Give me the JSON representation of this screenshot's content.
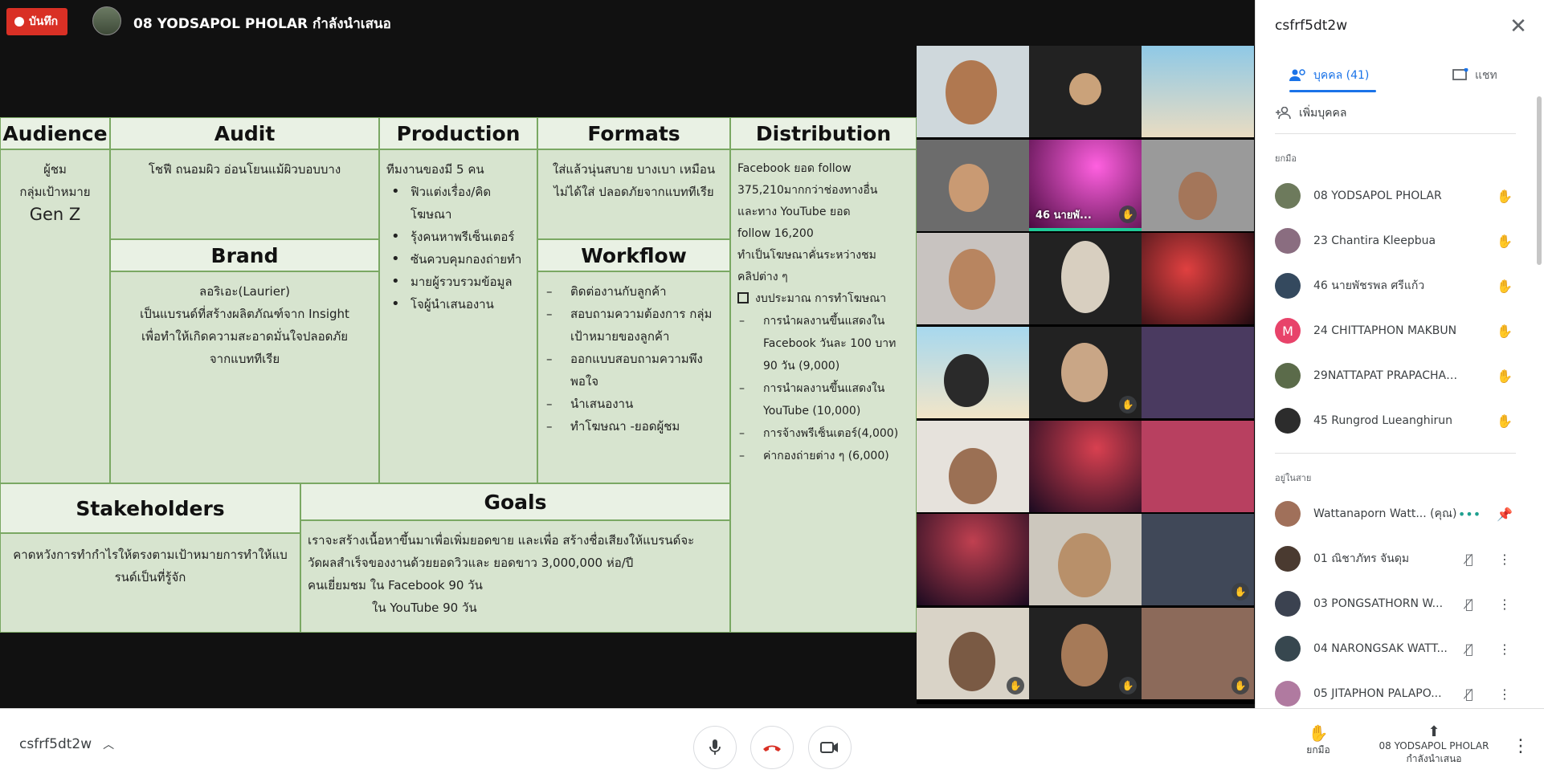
{
  "meeting": {
    "record_label": "บันทึก",
    "presenter_status": "08 YODSAPOL PHOLAR กำลังนำเสนอ",
    "code": "csfrf5dt2w"
  },
  "slide": {
    "audience": {
      "title": "Audience",
      "line1": "ผู้ชม",
      "line2": "กลุ่มเป้าหมาย",
      "line3": "Gen Z"
    },
    "audit": {
      "title": "Audit",
      "text": "โชฟี ถนอมผิว อ่อนโยนแม้ผิวบอบบาง"
    },
    "brand": {
      "title": "Brand",
      "line1": "ลอริเอะ(Laurier)",
      "line2": "เป็นแบรนด์ที่สร้างผลิตภัณฑ์จาก Insight",
      "line3": "เพื่อทำให้เกิดความสะอาดมั่นใจปลอดภัย",
      "line4": "จากแบททีเรีย"
    },
    "production": {
      "title": "Production",
      "intro": "ทีมงานของมี 5 คน",
      "items": [
        "ฟิวแต่งเรื่อง/คิดโฆษณา",
        "รุ้งคนหาพรีเซ็นเตอร์",
        "ซันควบคุมกองถ่ายทำ",
        "มายผู้รวบรวมข้อมูล",
        "โจผู้นำเสนองาน"
      ]
    },
    "formats": {
      "title": "Formats",
      "line1": "ใส่แล้วนุ่นสบาย บางเบา เหมือน",
      "line2": "ไม่ได้ใส่ ปลอดภัยจากแบททีเรีย"
    },
    "workflow": {
      "title": "Workflow",
      "items": [
        "ติดต่องานกับลูกค้า",
        "สอบถามความต้องการ กลุ่มเป้าหมายของลูกค้า",
        "ออกแบบสอบถามความพึงพอใจ",
        "นำเสนองาน",
        "ทำโฆษณา -ยอดผู้ชม"
      ]
    },
    "distribution": {
      "title": "Distribution",
      "l1": "Facebook ยอด follow",
      "l2": "375,210มากกว่าช่องทางอื่น",
      "l3": "และทาง YouTube ยอด",
      "l4": "follow 16,200",
      "l5": "ทำเป็นโฆษณาคั่นระหว่างชม",
      "l6": "คลิปต่าง ๆ",
      "budget": "งบประมาณ การทำโฆษณา",
      "items": [
        "การนำผลงานขึ้นแสดงใน Facebook วันละ 100 บาท 90 วัน (9,000)",
        "การนำผลงานขึ้นแสดงใน YouTube (10,000)",
        "การจ้างพรีเซ็นเตอร์(4,000)",
        "ค่ากองถ่ายต่าง ๆ (6,000)"
      ]
    },
    "stakeholders": {
      "title": "Stakeholders",
      "line1": "คาดหวังการทำกำไรให้ตรงตามเป้าหมายการทำให้แบ",
      "line2": "รนด์เป็นที่รู้จัก"
    },
    "goals": {
      "title": "Goals",
      "line1": "เราจะสร้างเนื้อหาขึ้นมาเพื่อเพิ่มยอดขาย และเพื่อ สร้างชื่อเสียงให้แบรนด์จะ",
      "line2": "วัดผลสำเร็จของงานด้วยยอดวิวและ  ยอดขาว 3,000,000 ห่อ/ปี",
      "line3": "คนเยี่ยมชม ใน Facebook    90 วัน",
      "line4": "ใน YouTube    90 วัน"
    }
  },
  "video": {
    "active_name": "46 นายพั..."
  },
  "panel": {
    "title": "csfrf5dt2w",
    "tab_people": "บุคคล (41)",
    "tab_chat": "แชท",
    "add_people": "เพิ่มบุคคล",
    "section_raised": "ยกมือ",
    "section_incall": "อยู่ในสาย",
    "raised": [
      {
        "name": "08 YODSAPOL PHOLAR",
        "initial": "",
        "color": "#6d7a5c"
      },
      {
        "name": "23 Chantira Kleepbua",
        "initial": "",
        "color": "#8a6d80"
      },
      {
        "name": "46 นายพัชรพล ศรีแก้ว",
        "initial": "",
        "color": "#34495e"
      },
      {
        "name": "24 CHITTAPHON MAKBUN",
        "initial": "M",
        "color": "#e8436a"
      },
      {
        "name": "29NATTAPAT PRAPACHAIMON...",
        "initial": "",
        "color": "#5b6b4a"
      },
      {
        "name": "45 Rungrod Lueanghirun",
        "initial": "",
        "color": "#2c2c2c"
      }
    ],
    "incall": [
      {
        "name": "Wattanaporn Watt...  (คุณ)",
        "initial": "",
        "color": "#a0705a"
      },
      {
        "name": "01 ณิชาภัทร จันดุม",
        "initial": "",
        "color": "#4a3a30"
      },
      {
        "name": "03 PONGSATHORN W...",
        "initial": "",
        "color": "#3b4250"
      },
      {
        "name": "04 NARONGSAK WATT...",
        "initial": "",
        "color": "#37474f"
      },
      {
        "name": "05 JITAPHON PALAPO...",
        "initial": "",
        "color": "#b07aa0"
      }
    ]
  },
  "bottom": {
    "raise_hand": "ยกมือ",
    "present_line1": "08 YODSAPOL PHOLAR",
    "present_line2": "กำลังนำเสนอ"
  }
}
